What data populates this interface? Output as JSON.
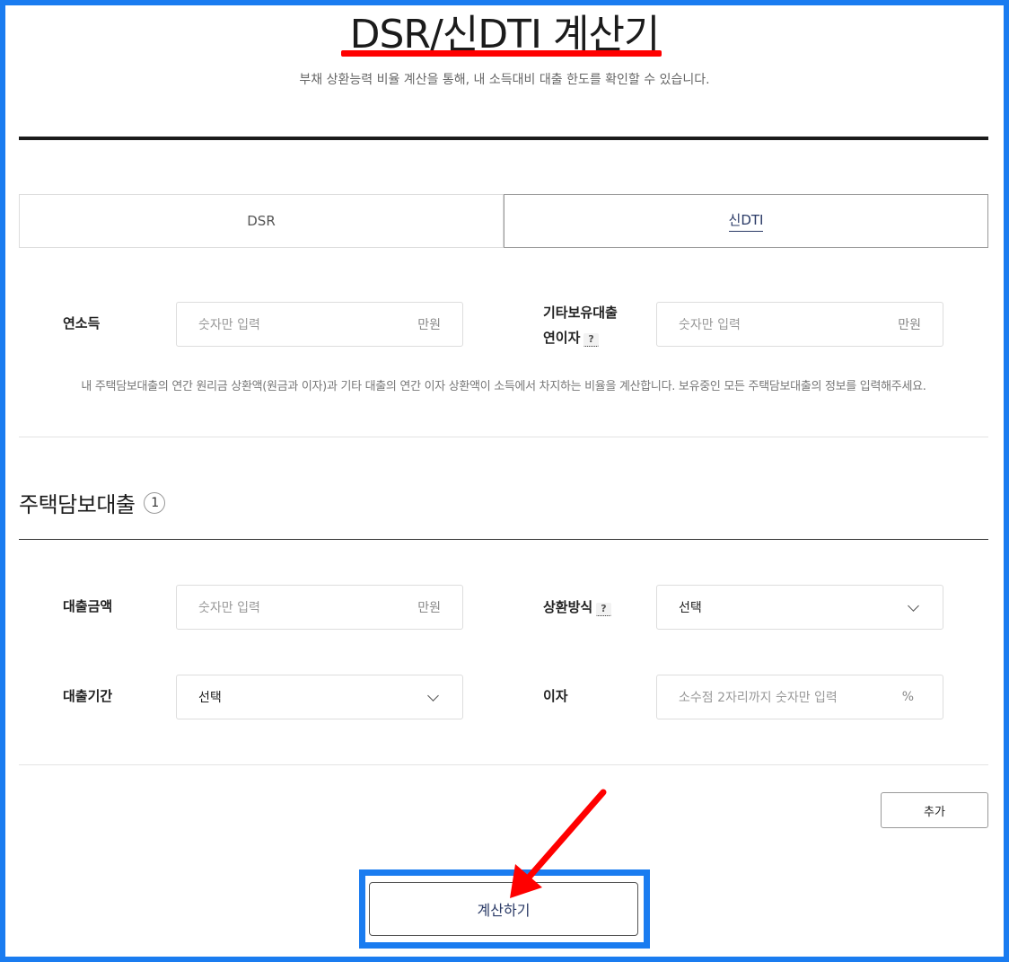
{
  "header": {
    "title": "DSR/신DTI 계산기",
    "subtitle": "부채 상환능력 비율 계산을 통해, 내 소득대비 대출 한도를 확인할 수 있습니다."
  },
  "tabs": [
    {
      "label": "DSR",
      "active": false
    },
    {
      "label": "신DTI",
      "active": true
    }
  ],
  "income": {
    "label": "연소득",
    "placeholder": "숫자만 입력",
    "unit": "만원"
  },
  "other_loan_interest": {
    "label_line1": "기타보유대출",
    "label_line2": "연이자",
    "help": "?",
    "placeholder": "숫자만 입력",
    "unit": "만원"
  },
  "description": "내 주택담보대출의 연간 원리금 상환액(원금과 이자)과 기타 대출의 연간 이자 상환액이 소득에서 차지하는 비율을 계산합니다. 보유중인 모든 주택담보대출의 정보를 입력해주세요.",
  "mortgage_section": {
    "title": "주택담보대출",
    "count": "1"
  },
  "loan_amount": {
    "label": "대출금액",
    "placeholder": "숫자만 입력",
    "unit": "만원"
  },
  "repayment_method": {
    "label": "상환방식",
    "help": "?",
    "value": "선택"
  },
  "loan_period": {
    "label": "대출기간",
    "value": "선택"
  },
  "interest": {
    "label": "이자",
    "placeholder": "소수점 2자리까지 숫자만 입력",
    "unit": "%"
  },
  "buttons": {
    "add": "추가",
    "calculate": "계산하기"
  },
  "colors": {
    "annotation_red": "#ff0000",
    "annotation_blue": "#1a7cf0",
    "accent_navy": "#2a3a66"
  }
}
